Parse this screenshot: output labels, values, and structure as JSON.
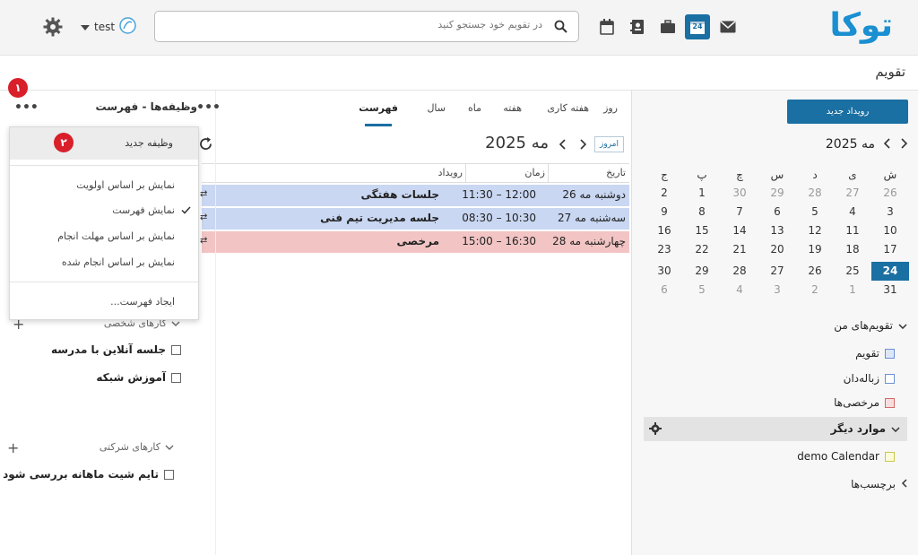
{
  "app": {
    "brand": "توکا",
    "page_title": "تقویم"
  },
  "topbar": {
    "search_placeholder": "در تقویم خود جستجو کنید",
    "user_name": "test",
    "date_icon_day": "24",
    "icons": [
      "mail-icon",
      "calendar-app-icon",
      "briefcase-icon",
      "contacts-icon",
      "calendar-icon",
      "search-icon",
      "gear-icon"
    ]
  },
  "sidebar": {
    "new_event_label": "رویداد جدید",
    "month_title": "مه 2025",
    "weekdays": [
      "ش",
      "ی",
      "د",
      "س",
      "چ",
      "پ",
      "ج"
    ],
    "weeks": [
      [
        "26",
        "27",
        "28",
        "29",
        "30",
        "1",
        "2"
      ],
      [
        "3",
        "4",
        "5",
        "6",
        "7",
        "8",
        "9"
      ],
      [
        "10",
        "11",
        "12",
        "13",
        "14",
        "15",
        "16"
      ],
      [
        "17",
        "18",
        "19",
        "20",
        "21",
        "22",
        "23"
      ],
      [
        "24",
        "25",
        "26",
        "27",
        "28",
        "29",
        "30"
      ],
      [
        "31",
        "1",
        "2",
        "3",
        "4",
        "5",
        "6"
      ]
    ],
    "my_calendars_label": "تقویم‌های من",
    "calendars": [
      {
        "label": "تقویم",
        "color": "#6b8fd6"
      },
      {
        "label": "زباله‌دان",
        "color": "#6b8fd6"
      },
      {
        "label": "مرخصی‌ها",
        "color": "#d46a6a"
      }
    ],
    "other_label": "موارد دیگر",
    "other_calendars": [
      {
        "label": "demo Calendar",
        "color": "#c8c850"
      }
    ],
    "tags_label": "برچسب‌ها"
  },
  "calendar_view": {
    "tabs": [
      "روز",
      "هفته کاری",
      "هفته",
      "ماه",
      "سال",
      "فهرست"
    ],
    "active_tab": "فهرست",
    "today_label": "امروز",
    "period_title": "مه 2025",
    "columns": {
      "date": "تاریخ",
      "time": "زمان",
      "event": "رویداد"
    },
    "events": [
      {
        "date": "دوشنبه مه 26",
        "time": "11:30 – 12:00",
        "title": "جلسات هفتگی",
        "color": "#c9d7f2"
      },
      {
        "date": "سه‌شنبه مه 27",
        "time": "08:30 – 10:30",
        "title": "جلسه مدیریت تیم فنی",
        "color": "#c9d7f2"
      },
      {
        "date": "چهارشنبه مه 28",
        "time": "15:00 – 16:30",
        "title": "مرخصی",
        "color": "#f2c4c4"
      }
    ]
  },
  "tasks": {
    "header": "وظیفه‌ها - فهرست",
    "menu": {
      "new_task": "وظیفه جدید",
      "sort_priority": "نمایش بر اساس اولویت",
      "show_list": "نمایش فهرست",
      "sort_due": "نمایش بر اساس مهلت انجام",
      "sort_done": "نمایش بر اساس انجام شده",
      "create_list": "ایجاد فهرست..."
    },
    "badges": [
      "۱",
      "۲"
    ],
    "personal_label": "کارهای شخصی",
    "personal_items": [
      "جلسه آنلاین با مدرسه",
      "آموزش شبکه"
    ],
    "company_label": "کارهای شرکتی",
    "company_items": [
      "تایم شیت ماهانه بررسی شود"
    ]
  }
}
